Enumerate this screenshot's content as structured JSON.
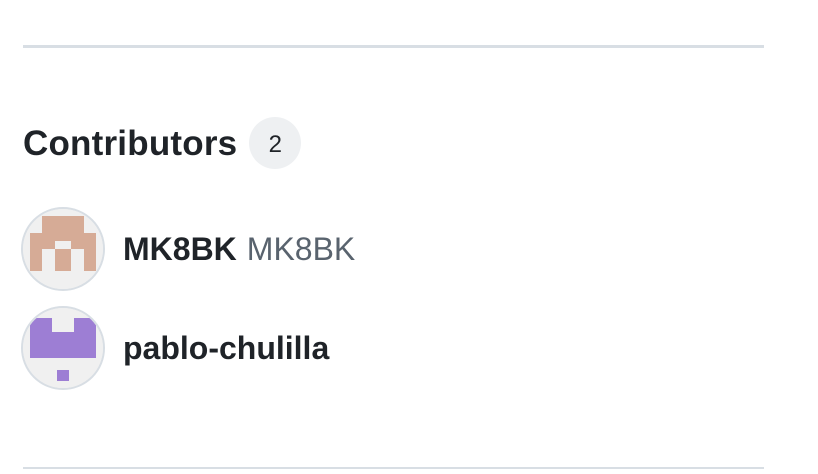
{
  "contributors_section": {
    "heading": "Contributors",
    "count": "2",
    "items": [
      {
        "login": "MK8BK",
        "name": "MK8BK",
        "avatar_icon": "identicon-avatar",
        "avatar_color": "#d6ab96"
      },
      {
        "login": "pablo-chulilla",
        "name": "",
        "avatar_icon": "identicon-avatar",
        "avatar_color": "#9d7ed4"
      }
    ]
  }
}
